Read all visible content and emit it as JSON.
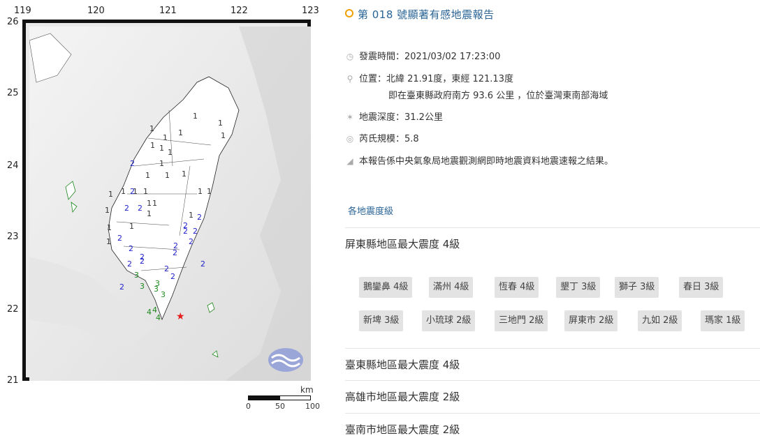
{
  "map": {
    "lon_labels": [
      "119",
      "120",
      "121",
      "122",
      "123"
    ],
    "lat_labels": [
      "26",
      "25",
      "24",
      "23",
      "22",
      "21"
    ],
    "scale_unit": "km",
    "scale_ticks": [
      "0",
      "50",
      "100"
    ],
    "stations": [
      {
        "v": "1"
      },
      {
        "v": "1"
      },
      {
        "v": "1"
      },
      {
        "v": "1"
      },
      {
        "v": "1"
      },
      {
        "v": "1"
      },
      {
        "v": "1"
      },
      {
        "v": "1"
      },
      {
        "v": "1"
      },
      {
        "v": "1"
      },
      {
        "v": "1"
      },
      {
        "v": "1"
      },
      {
        "v": "1"
      },
      {
        "v": "1"
      },
      {
        "v": "1"
      },
      {
        "v": "1"
      },
      {
        "v": "1"
      },
      {
        "v": "1"
      },
      {
        "v": "1"
      },
      {
        "v": "1"
      },
      {
        "v": "1"
      },
      {
        "v": "1"
      },
      {
        "v": "1"
      },
      {
        "v": "1"
      },
      {
        "v": "1"
      },
      {
        "v": "1"
      },
      {
        "v": "1"
      },
      {
        "v": "2"
      },
      {
        "v": "2"
      },
      {
        "v": "2"
      },
      {
        "v": "2"
      },
      {
        "v": "2"
      },
      {
        "v": "2"
      },
      {
        "v": "2"
      },
      {
        "v": "2"
      },
      {
        "v": "2"
      },
      {
        "v": "2"
      },
      {
        "v": "2"
      },
      {
        "v": "2"
      },
      {
        "v": "2"
      },
      {
        "v": "2"
      },
      {
        "v": "2"
      },
      {
        "v": "2"
      },
      {
        "v": "2"
      },
      {
        "v": "2"
      },
      {
        "v": "2"
      },
      {
        "v": "2"
      },
      {
        "v": "3"
      },
      {
        "v": "3"
      },
      {
        "v": "3"
      },
      {
        "v": "3"
      },
      {
        "v": "3"
      },
      {
        "v": "4"
      },
      {
        "v": "4"
      },
      {
        "v": "4"
      }
    ]
  },
  "report": {
    "title": "第 018 號顯著有感地震報告",
    "time": "發震時間：2021/03/02 17:23:00",
    "location": "位置：北緯 21.91度，東經 121.13度",
    "location_detail": "即在臺東縣政府南方 93.6 公里 ，位於臺灣東南部海域",
    "depth": "地震深度：31.2公里",
    "magnitude": "芮氏規模：5.8",
    "note": "本報告係中央氣象局地震觀測網即時地震資料地震速報之結果。",
    "section_heading": "各地震度級",
    "counties": [
      "屏東縣地區最大震度 4級",
      "臺東縣地區最大震度 4級",
      "高雄市地區最大震度 2級",
      "臺南市地區最大震度 2級"
    ],
    "pingtung_stations": [
      "鵝鑾鼻 4級",
      "滿州 4級",
      "恆春 4級",
      "墾丁 3級",
      "獅子 3級",
      "春日 3級",
      "新埤 3級",
      "小琉球 2級",
      "三地門 2級",
      "屏東市 2級",
      "九如 2級",
      "瑪家 1級"
    ]
  }
}
